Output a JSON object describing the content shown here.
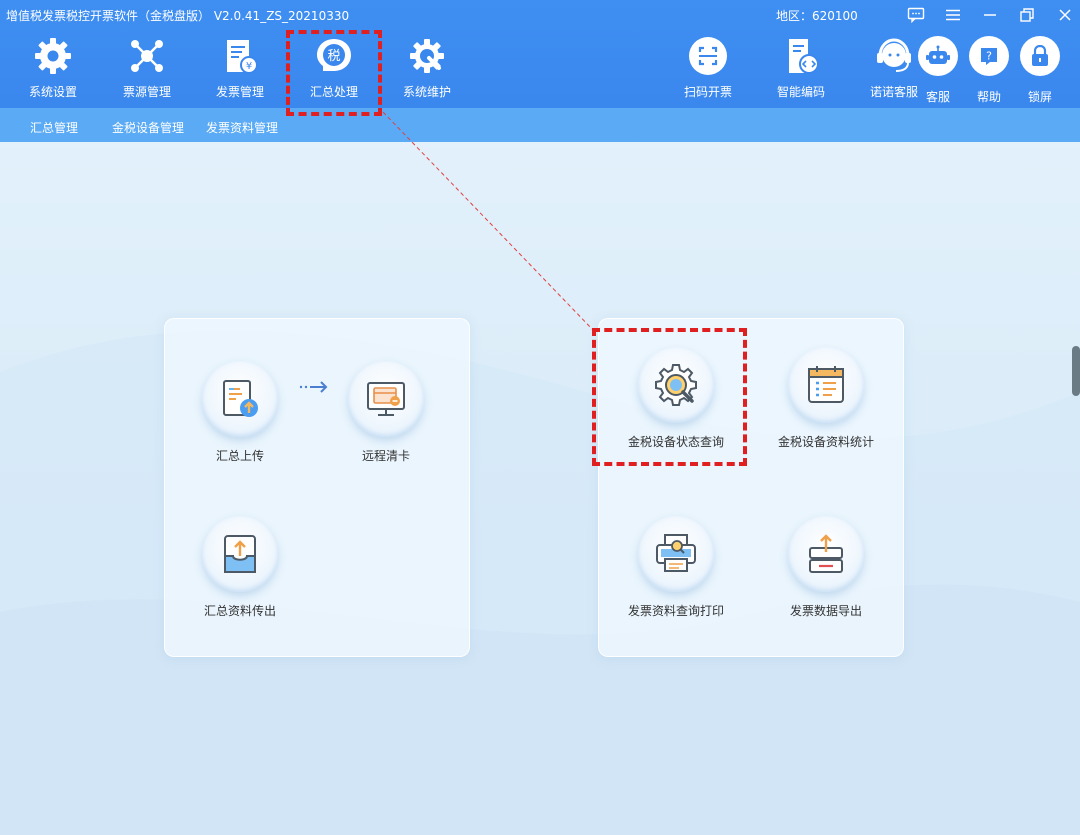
{
  "window": {
    "title": "增值税发票税控开票软件（金税盘版） V2.0.41_ZS_20210330",
    "region": "地区：620100"
  },
  "nav": {
    "items": [
      {
        "label": "系统设置",
        "icon": "gear-icon"
      },
      {
        "label": "票源管理",
        "icon": "network-icon"
      },
      {
        "label": "发票管理",
        "icon": "invoice-icon"
      },
      {
        "label": "汇总处理",
        "icon": "tax-icon",
        "selected": true
      },
      {
        "label": "系统维护",
        "icon": "wrench-gear-icon"
      }
    ],
    "right_items": [
      {
        "label": "扫码开票",
        "icon": "scan-icon"
      },
      {
        "label": "智能编码",
        "icon": "code-doc-icon"
      },
      {
        "label": "诺诺客服",
        "icon": "headset-icon"
      }
    ],
    "round_buttons": [
      {
        "label": "客服",
        "icon": "robot-icon"
      },
      {
        "label": "帮助",
        "icon": "help-icon"
      },
      {
        "label": "锁屏",
        "icon": "lock-icon"
      }
    ]
  },
  "subnav": {
    "items": [
      "汇总管理",
      "金税设备管理",
      "发票资料管理"
    ]
  },
  "left_panel": {
    "items": [
      {
        "label": "汇总上传",
        "icon": "upload-doc-icon"
      },
      {
        "label": "远程清卡",
        "icon": "monitor-card-icon"
      },
      {
        "label": "汇总资料传出",
        "icon": "tray-upload-icon"
      }
    ]
  },
  "right_panel": {
    "items": [
      {
        "label": "金税设备状态查询",
        "icon": "gear-search-icon"
      },
      {
        "label": "金税设备资料统计",
        "icon": "calendar-list-icon"
      },
      {
        "label": "发票资料查询打印",
        "icon": "printer-search-icon"
      },
      {
        "label": "发票数据导出",
        "icon": "export-icon"
      }
    ]
  },
  "colors": {
    "header_blue": "#3a87ee",
    "subnav_blue": "#5aaaf5",
    "highlight_red": "#e02020"
  }
}
